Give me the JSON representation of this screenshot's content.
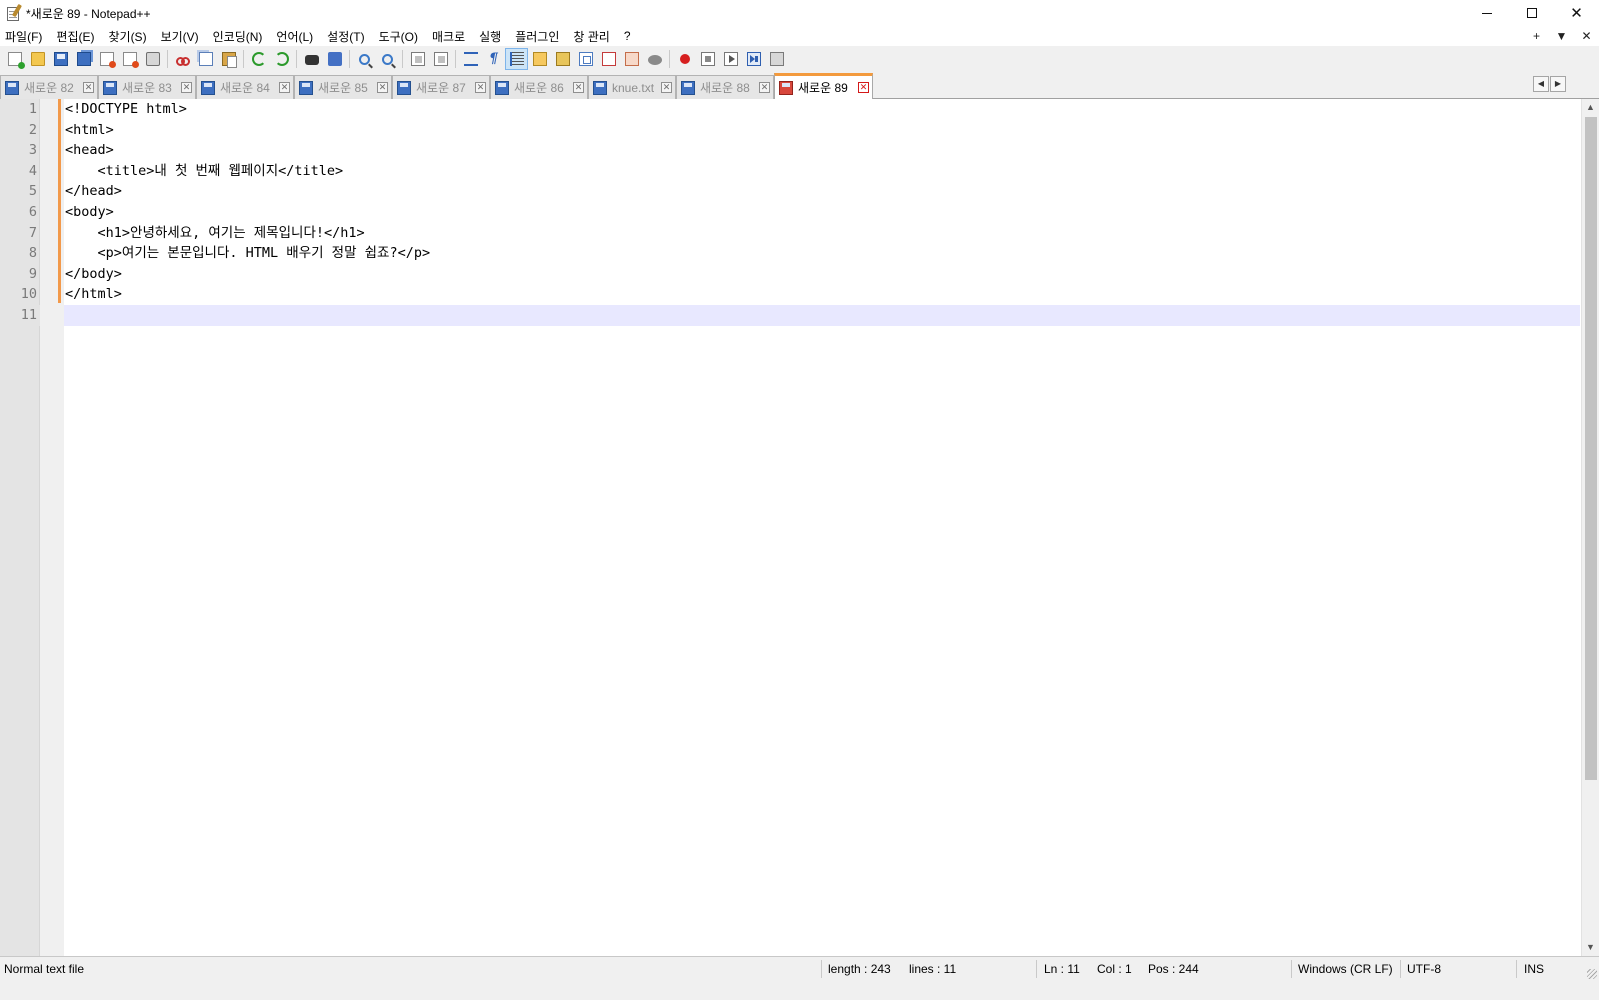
{
  "window": {
    "title": "*새로운 89 - Notepad++"
  },
  "menu": {
    "items": [
      "파일(F)",
      "편집(E)",
      "찾기(S)",
      "보기(V)",
      "인코딩(N)",
      "언어(L)",
      "설정(T)",
      "도구(O)",
      "매크로",
      "실행",
      "플러그인",
      "창 관리",
      "?"
    ],
    "right": [
      "+",
      "▼",
      "✕"
    ]
  },
  "toolbar": {
    "icons": [
      "new-file-icon",
      "open-file-icon",
      "save-icon",
      "save-all-icon",
      "close-icon",
      "close-all-icon",
      "print-icon",
      "cut-icon",
      "copy-icon",
      "paste-icon",
      "undo-icon",
      "redo-icon",
      "find-icon",
      "replace-icon",
      "zoom-in-icon",
      "zoom-out-icon",
      "sync-vertical-icon",
      "sync-horizontal-icon",
      "word-wrap-icon",
      "show-all-characters-icon",
      "indent-guide-icon",
      "user-language-icon",
      "xml-icon",
      "document-map-icon",
      "function-list-icon",
      "folder-as-workspace-icon",
      "monitoring-icon",
      "record-macro-icon",
      "stop-recording-icon",
      "playback-icon",
      "playback-multiple-icon",
      "save-macro-icon"
    ]
  },
  "tabs": [
    {
      "label": "새로운 82",
      "active": false
    },
    {
      "label": "새로운 83",
      "active": false
    },
    {
      "label": "새로운 84",
      "active": false
    },
    {
      "label": "새로운 85",
      "active": false
    },
    {
      "label": "새로운 87",
      "active": false
    },
    {
      "label": "새로운 86",
      "active": false
    },
    {
      "label": "knue.txt",
      "active": false
    },
    {
      "label": "새로운 88",
      "active": false
    },
    {
      "label": "새로운 89",
      "active": true
    }
  ],
  "tab_close_glyph": "✕",
  "tab_scroll": {
    "left": "◀",
    "right": "▶"
  },
  "editor": {
    "lines": [
      {
        "num": "1",
        "text": "<!DOCTYPE html>"
      },
      {
        "num": "2",
        "text": "<html>"
      },
      {
        "num": "3",
        "text": "<head>"
      },
      {
        "num": "4",
        "text": "    <title>내 첫 번째 웹페이지</title>"
      },
      {
        "num": "5",
        "text": "</head>"
      },
      {
        "num": "6",
        "text": "<body>"
      },
      {
        "num": "7",
        "text": "    <h1>안녕하세요, 여기는 제목입니다!</h1>"
      },
      {
        "num": "8",
        "text": "    <p>여기는 본문입니다. HTML 배우기 정말 쉽죠?</p>"
      },
      {
        "num": "9",
        "text": "</body>"
      },
      {
        "num": "10",
        "text": "</html>"
      },
      {
        "num": "11",
        "text": ""
      }
    ],
    "current_line": 11,
    "current_line_color": "#e8e8ff",
    "change_bar_color": "#f2994a"
  },
  "scrollbar": {
    "up": "▲",
    "down": "▼"
  },
  "status": {
    "file_type": "Normal text file",
    "length": "length : 243",
    "lines": "lines : 11",
    "ln": "Ln : 11",
    "col": "Col : 1",
    "pos": "Pos : 244",
    "eol": "Windows (CR LF)",
    "encoding": "UTF-8",
    "mode": "INS"
  },
  "colors": {
    "active_tab_accent": "#f39a3d",
    "active_tab_close": "#d41919"
  }
}
